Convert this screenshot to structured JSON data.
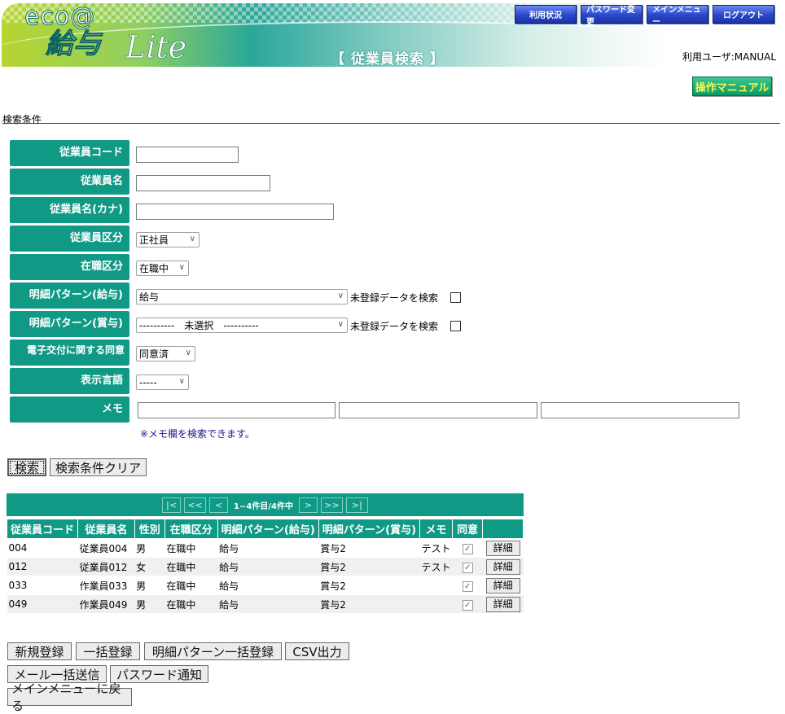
{
  "header": {
    "logo_eco": "eco@",
    "logo_kyuyo": "給与",
    "logo_lite": "Lite",
    "page_title": "【 従業員検索 】",
    "user_info": "利用ユーザ:MANUAL",
    "nav": [
      "利用状況",
      "パスワード変更",
      "メインメニュー",
      "ログアウト"
    ],
    "manual_button": "操作マニュアル"
  },
  "search": {
    "section_label": "検索条件",
    "fields": {
      "emp_code": "従業員コード",
      "emp_name": "従業員名",
      "emp_kana": "従業員名(カナ)",
      "emp_type": "従業員区分",
      "status": "在職区分",
      "pattern_salary": "明細パターン(給与)",
      "pattern_bonus": "明細パターン(賞与)",
      "consent": "電子交付に関する同意",
      "language": "表示言語",
      "memo": "メモ"
    },
    "values": {
      "emp_code": "",
      "emp_name": "",
      "emp_kana": "",
      "emp_type": "正社員",
      "status": "在職中",
      "pattern_salary": "給与",
      "pattern_bonus": "----------　未選択　----------",
      "consent": "同意済",
      "language": "-----",
      "memo1": "",
      "memo2": "",
      "memo3": ""
    },
    "unregistered_label": "未登録データを検索",
    "memo_note": "※メモ欄を検索できます。",
    "search_button": "検索",
    "clear_button": "検索条件クリア"
  },
  "results": {
    "pager": {
      "first": "|<",
      "prev_block": "<<",
      "prev": "<",
      "info": "1~4件目/4件中",
      "next": ">",
      "next_block": ">>",
      "last": ">|"
    },
    "columns": [
      "従業員コード",
      "従業員名",
      "性別",
      "在職区分",
      "明細パターン(給与)",
      "明細パターン(賞与)",
      "メモ",
      "同意",
      ""
    ],
    "rows": [
      {
        "code": "004",
        "name": "従業員004",
        "gender": "男",
        "status": "在職中",
        "salary": "給与",
        "bonus": "賞与2",
        "memo": "テスト",
        "consent": "✓",
        "detail": "詳細"
      },
      {
        "code": "012",
        "name": "従業員012",
        "gender": "女",
        "status": "在職中",
        "salary": "給与",
        "bonus": "賞与2",
        "memo": "テスト",
        "consent": "✓",
        "detail": "詳細"
      },
      {
        "code": "033",
        "name": "作業員033",
        "gender": "男",
        "status": "在職中",
        "salary": "給与",
        "bonus": "賞与2",
        "memo": "",
        "consent": "✓",
        "detail": "詳細"
      },
      {
        "code": "049",
        "name": "作業員049",
        "gender": "男",
        "status": "在職中",
        "salary": "給与",
        "bonus": "賞与2",
        "memo": "",
        "consent": "✓",
        "detail": "詳細"
      }
    ]
  },
  "actions": {
    "new": "新規登録",
    "bulk": "一括登録",
    "pattern_bulk": "明細パターン一括登録",
    "csv": "CSV出力",
    "mail_bulk": "メール一括送信",
    "password_notify": "パスワード通知",
    "back_main": "メインメニューに戻る"
  }
}
